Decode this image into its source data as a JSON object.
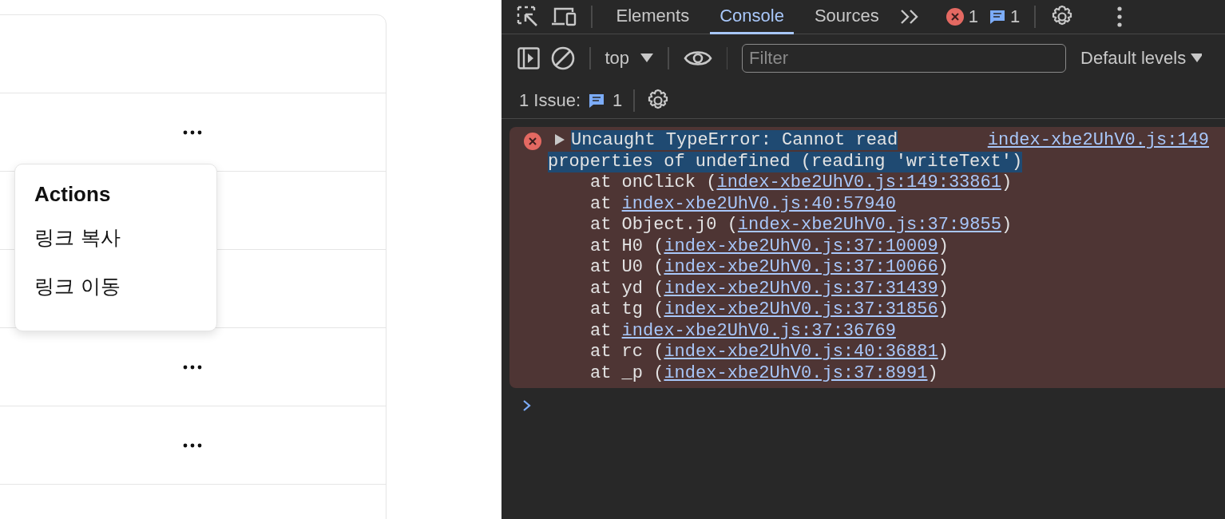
{
  "page": {
    "rows": [
      {
        "has_actions": false
      },
      {
        "has_actions": true
      },
      {
        "has_actions": false
      },
      {
        "has_actions": false
      },
      {
        "has_actions": true
      },
      {
        "has_actions": true
      },
      {
        "has_actions": false
      }
    ],
    "menu": {
      "title": "Actions",
      "items": [
        "링크 복사",
        "링크 이동"
      ]
    }
  },
  "devtools": {
    "tabs": [
      {
        "label": "Elements",
        "selected": false
      },
      {
        "label": "Console",
        "selected": true
      },
      {
        "label": "Sources",
        "selected": false
      }
    ],
    "error_count": "1",
    "issue_count": "1",
    "toolbar": {
      "context": "top",
      "filter_placeholder": "Filter",
      "levels": "Default levels"
    },
    "issues": {
      "label": "1 Issue:",
      "count": "1"
    },
    "console": {
      "error": {
        "message": [
          "Uncaught TypeError: Cannot read",
          "properties of undefined (reading 'writeText')"
        ],
        "selected": true,
        "source": "index-xbe2UhV0.js:149",
        "stack": [
          {
            "text": "at onClick (",
            "link": "index-xbe2UhV0.js:149:33861",
            "tail": ")"
          },
          {
            "text": "at ",
            "link": "index-xbe2UhV0.js:40:57940"
          },
          {
            "text": "at Object.j0 (",
            "link": "index-xbe2UhV0.js:37:9855",
            "tail": ")"
          },
          {
            "text": "at H0 (",
            "link": "index-xbe2UhV0.js:37:10009",
            "tail": ")"
          },
          {
            "text": "at U0 (",
            "link": "index-xbe2UhV0.js:37:10066",
            "tail": ")"
          },
          {
            "text": "at yd (",
            "link": "index-xbe2UhV0.js:37:31439",
            "tail": ")"
          },
          {
            "text": "at tg (",
            "link": "index-xbe2UhV0.js:37:31856",
            "tail": ")"
          },
          {
            "text": "at ",
            "link": "index-xbe2UhV0.js:37:36769"
          },
          {
            "text": "at rc (",
            "link": "index-xbe2UhV0.js:40:36881",
            "tail": ")"
          },
          {
            "text": "at _p (",
            "link": "index-xbe2UhV0.js:37:8991",
            "tail": ")"
          }
        ]
      }
    }
  }
}
